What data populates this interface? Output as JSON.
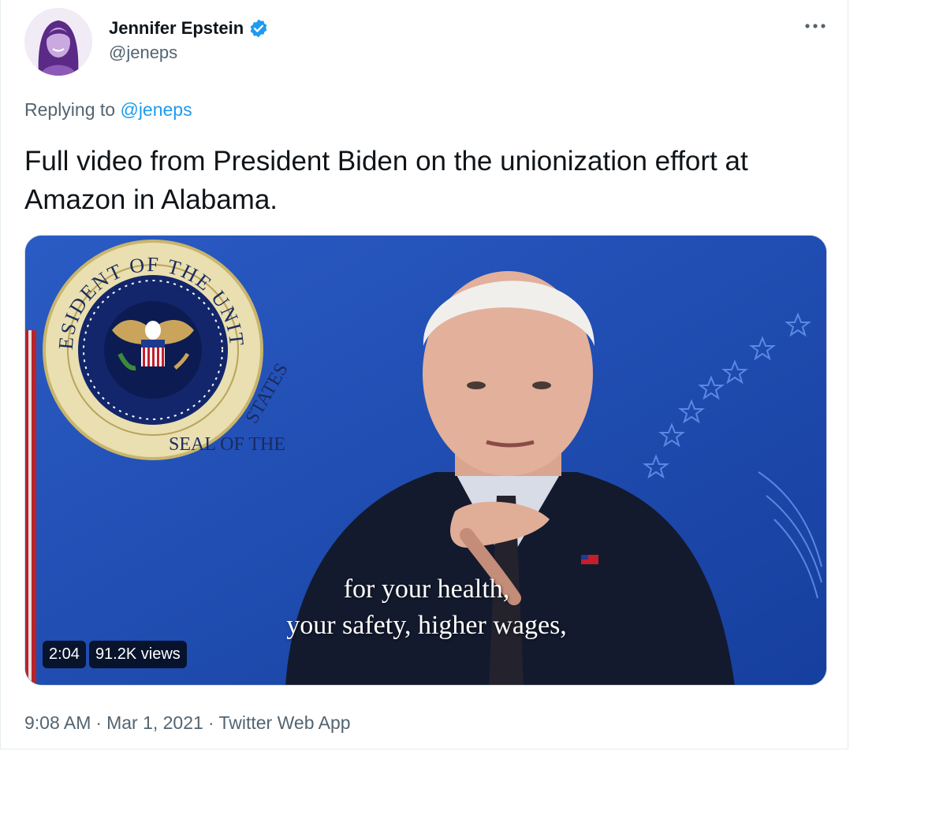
{
  "author": {
    "display_name": "Jennifer Epstein",
    "handle": "@jeneps",
    "verified_icon": "verified-badge-icon"
  },
  "reply": {
    "prefix": "Replying to",
    "handle": "@jeneps"
  },
  "tweet": {
    "text": "Full video from President Biden on the unionization effort at Amazon in Alabama."
  },
  "video": {
    "caption_line1": "for your health,",
    "caption_line2": "your safety, higher wages,",
    "duration": "2:04",
    "views": "91.2K views",
    "seal_top_text": "PRESIDENT OF THE UNITED",
    "seal_bottom_text": "SEAL OF THE",
    "seal_right_text": "STATES"
  },
  "meta": {
    "time": "9:08 AM",
    "date": "Mar 1, 2021",
    "source": "Twitter Web App",
    "separator": "·"
  },
  "colors": {
    "link": "#1d9bf0",
    "secondary_text": "#536471",
    "primary_text": "#0f1419",
    "video_bg": "#1f4fb0"
  }
}
